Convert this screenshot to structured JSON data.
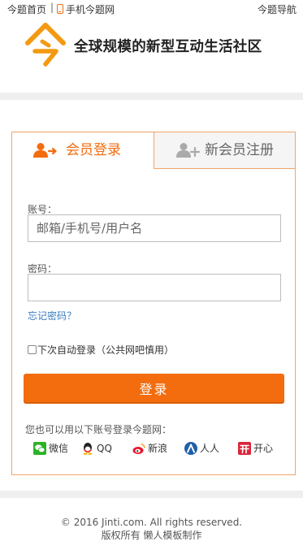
{
  "topbar": {
    "home_link": "今题首页",
    "separator": "|",
    "mobile_link": "手机今题网",
    "nav_link": "今题导航"
  },
  "brand": {
    "slogan": "全球规模的新型互动生活社区",
    "accent_color": "#f36c0e"
  },
  "tabs": {
    "login": "会员登录",
    "register": "新会员注册"
  },
  "form": {
    "account_label": "账号：",
    "account_placeholder": "邮箱/手机号/用户名",
    "account_value": "",
    "password_label": "密码：",
    "password_value": "",
    "forgot_link": "忘记密码？",
    "remember_label": "下次自动登录（公共网吧慎用）",
    "remember_checked": false,
    "submit_label": "登录"
  },
  "social": {
    "title": "您也可以用以下账号登录今题网：",
    "items": [
      {
        "label": "微信",
        "icon": "wechat-icon"
      },
      {
        "label": "QQ",
        "icon": "qq-icon"
      },
      {
        "label": "新浪",
        "icon": "weibo-icon"
      },
      {
        "label": "人人",
        "icon": "renren-icon"
      },
      {
        "label": "开心",
        "icon": "kaixin-icon"
      }
    ]
  },
  "footer": {
    "copyright": "© 2016 Jinti.com. All rights reserved.",
    "credit": "版权所有 懒人模板制作"
  }
}
